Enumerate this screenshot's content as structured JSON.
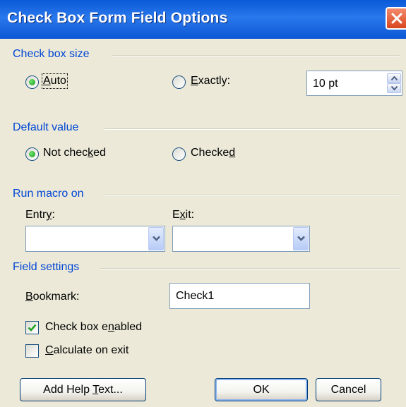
{
  "window": {
    "title": "Check Box Form Field Options"
  },
  "check_box_size": {
    "heading": "Check box size",
    "auto": {
      "pre": "",
      "key": "A",
      "post": "uto",
      "selected": true
    },
    "exactly": {
      "pre": "",
      "key": "E",
      "post": "xactly:",
      "selected": false
    },
    "size_value": "10 pt"
  },
  "default_value": {
    "heading": "Default value",
    "not_checked": {
      "pre": "Not chec",
      "key": "k",
      "post": "ed",
      "selected": true
    },
    "checked": {
      "pre": "Checke",
      "key": "d",
      "post": "",
      "selected": false
    }
  },
  "run_macro": {
    "heading": "Run macro on",
    "entry": {
      "pre": "Entr",
      "key": "y",
      "post": ":",
      "value": ""
    },
    "exit": {
      "pre": "E",
      "key": "x",
      "post": "it:",
      "value": ""
    }
  },
  "field_settings": {
    "heading": "Field settings",
    "bookmark": {
      "pre": "",
      "key": "B",
      "post": "ookmark:",
      "value": "Check1"
    },
    "check_box_enabled": {
      "pre": "Check box e",
      "key": "n",
      "post": "abled",
      "checked": true
    },
    "calculate_on_exit": {
      "pre": "",
      "key": "C",
      "post": "alculate on exit",
      "checked": false
    }
  },
  "buttons": {
    "add_help_text": {
      "pre": "Add Help ",
      "key": "T",
      "post": "ext..."
    },
    "ok": "OK",
    "cancel": "Cancel"
  },
  "icons": {
    "close": "close-icon",
    "spin_up": "spin-up-icon",
    "spin_down": "spin-down-icon",
    "dropdown": "chevron-down-icon",
    "check": "checkmark-icon"
  },
  "colors": {
    "titlebar": "#0a5ad8",
    "group_heading": "#0046d5",
    "close_button": "#d9451e",
    "dialog_bg": "#ece9d8"
  }
}
